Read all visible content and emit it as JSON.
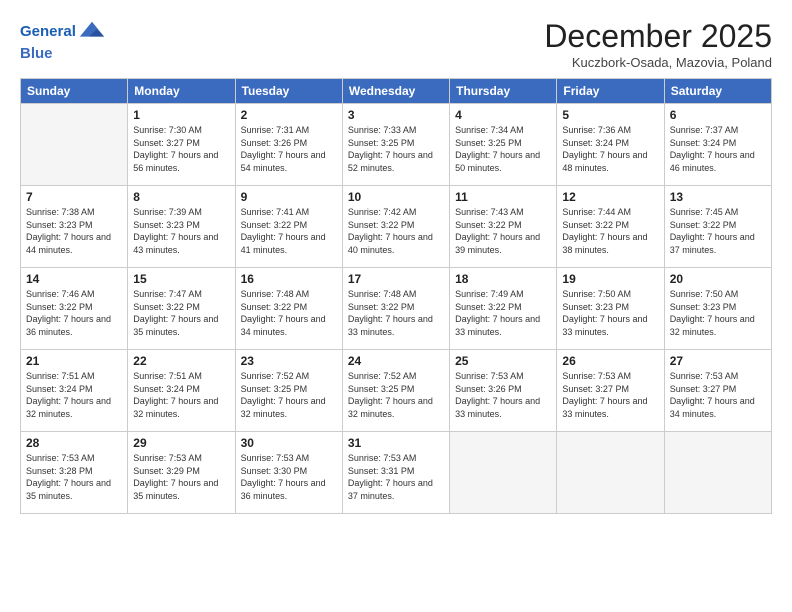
{
  "logo": {
    "line1": "General",
    "line2": "Blue"
  },
  "header": {
    "title": "December 2025",
    "location": "Kuczbork-Osada, Mazovia, Poland"
  },
  "weekdays": [
    "Sunday",
    "Monday",
    "Tuesday",
    "Wednesday",
    "Thursday",
    "Friday",
    "Saturday"
  ],
  "weeks": [
    [
      {
        "day": "",
        "sunrise": "",
        "sunset": "",
        "daylight": ""
      },
      {
        "day": "1",
        "sunrise": "Sunrise: 7:30 AM",
        "sunset": "Sunset: 3:27 PM",
        "daylight": "Daylight: 7 hours and 56 minutes."
      },
      {
        "day": "2",
        "sunrise": "Sunrise: 7:31 AM",
        "sunset": "Sunset: 3:26 PM",
        "daylight": "Daylight: 7 hours and 54 minutes."
      },
      {
        "day": "3",
        "sunrise": "Sunrise: 7:33 AM",
        "sunset": "Sunset: 3:25 PM",
        "daylight": "Daylight: 7 hours and 52 minutes."
      },
      {
        "day": "4",
        "sunrise": "Sunrise: 7:34 AM",
        "sunset": "Sunset: 3:25 PM",
        "daylight": "Daylight: 7 hours and 50 minutes."
      },
      {
        "day": "5",
        "sunrise": "Sunrise: 7:36 AM",
        "sunset": "Sunset: 3:24 PM",
        "daylight": "Daylight: 7 hours and 48 minutes."
      },
      {
        "day": "6",
        "sunrise": "Sunrise: 7:37 AM",
        "sunset": "Sunset: 3:24 PM",
        "daylight": "Daylight: 7 hours and 46 minutes."
      }
    ],
    [
      {
        "day": "7",
        "sunrise": "Sunrise: 7:38 AM",
        "sunset": "Sunset: 3:23 PM",
        "daylight": "Daylight: 7 hours and 44 minutes."
      },
      {
        "day": "8",
        "sunrise": "Sunrise: 7:39 AM",
        "sunset": "Sunset: 3:23 PM",
        "daylight": "Daylight: 7 hours and 43 minutes."
      },
      {
        "day": "9",
        "sunrise": "Sunrise: 7:41 AM",
        "sunset": "Sunset: 3:22 PM",
        "daylight": "Daylight: 7 hours and 41 minutes."
      },
      {
        "day": "10",
        "sunrise": "Sunrise: 7:42 AM",
        "sunset": "Sunset: 3:22 PM",
        "daylight": "Daylight: 7 hours and 40 minutes."
      },
      {
        "day": "11",
        "sunrise": "Sunrise: 7:43 AM",
        "sunset": "Sunset: 3:22 PM",
        "daylight": "Daylight: 7 hours and 39 minutes."
      },
      {
        "day": "12",
        "sunrise": "Sunrise: 7:44 AM",
        "sunset": "Sunset: 3:22 PM",
        "daylight": "Daylight: 7 hours and 38 minutes."
      },
      {
        "day": "13",
        "sunrise": "Sunrise: 7:45 AM",
        "sunset": "Sunset: 3:22 PM",
        "daylight": "Daylight: 7 hours and 37 minutes."
      }
    ],
    [
      {
        "day": "14",
        "sunrise": "Sunrise: 7:46 AM",
        "sunset": "Sunset: 3:22 PM",
        "daylight": "Daylight: 7 hours and 36 minutes."
      },
      {
        "day": "15",
        "sunrise": "Sunrise: 7:47 AM",
        "sunset": "Sunset: 3:22 PM",
        "daylight": "Daylight: 7 hours and 35 minutes."
      },
      {
        "day": "16",
        "sunrise": "Sunrise: 7:48 AM",
        "sunset": "Sunset: 3:22 PM",
        "daylight": "Daylight: 7 hours and 34 minutes."
      },
      {
        "day": "17",
        "sunrise": "Sunrise: 7:48 AM",
        "sunset": "Sunset: 3:22 PM",
        "daylight": "Daylight: 7 hours and 33 minutes."
      },
      {
        "day": "18",
        "sunrise": "Sunrise: 7:49 AM",
        "sunset": "Sunset: 3:22 PM",
        "daylight": "Daylight: 7 hours and 33 minutes."
      },
      {
        "day": "19",
        "sunrise": "Sunrise: 7:50 AM",
        "sunset": "Sunset: 3:23 PM",
        "daylight": "Daylight: 7 hours and 33 minutes."
      },
      {
        "day": "20",
        "sunrise": "Sunrise: 7:50 AM",
        "sunset": "Sunset: 3:23 PM",
        "daylight": "Daylight: 7 hours and 32 minutes."
      }
    ],
    [
      {
        "day": "21",
        "sunrise": "Sunrise: 7:51 AM",
        "sunset": "Sunset: 3:24 PM",
        "daylight": "Daylight: 7 hours and 32 minutes."
      },
      {
        "day": "22",
        "sunrise": "Sunrise: 7:51 AM",
        "sunset": "Sunset: 3:24 PM",
        "daylight": "Daylight: 7 hours and 32 minutes."
      },
      {
        "day": "23",
        "sunrise": "Sunrise: 7:52 AM",
        "sunset": "Sunset: 3:25 PM",
        "daylight": "Daylight: 7 hours and 32 minutes."
      },
      {
        "day": "24",
        "sunrise": "Sunrise: 7:52 AM",
        "sunset": "Sunset: 3:25 PM",
        "daylight": "Daylight: 7 hours and 32 minutes."
      },
      {
        "day": "25",
        "sunrise": "Sunrise: 7:53 AM",
        "sunset": "Sunset: 3:26 PM",
        "daylight": "Daylight: 7 hours and 33 minutes."
      },
      {
        "day": "26",
        "sunrise": "Sunrise: 7:53 AM",
        "sunset": "Sunset: 3:27 PM",
        "daylight": "Daylight: 7 hours and 33 minutes."
      },
      {
        "day": "27",
        "sunrise": "Sunrise: 7:53 AM",
        "sunset": "Sunset: 3:27 PM",
        "daylight": "Daylight: 7 hours and 34 minutes."
      }
    ],
    [
      {
        "day": "28",
        "sunrise": "Sunrise: 7:53 AM",
        "sunset": "Sunset: 3:28 PM",
        "daylight": "Daylight: 7 hours and 35 minutes."
      },
      {
        "day": "29",
        "sunrise": "Sunrise: 7:53 AM",
        "sunset": "Sunset: 3:29 PM",
        "daylight": "Daylight: 7 hours and 35 minutes."
      },
      {
        "day": "30",
        "sunrise": "Sunrise: 7:53 AM",
        "sunset": "Sunset: 3:30 PM",
        "daylight": "Daylight: 7 hours and 36 minutes."
      },
      {
        "day": "31",
        "sunrise": "Sunrise: 7:53 AM",
        "sunset": "Sunset: 3:31 PM",
        "daylight": "Daylight: 7 hours and 37 minutes."
      },
      {
        "day": "",
        "sunrise": "",
        "sunset": "",
        "daylight": ""
      },
      {
        "day": "",
        "sunrise": "",
        "sunset": "",
        "daylight": ""
      },
      {
        "day": "",
        "sunrise": "",
        "sunset": "",
        "daylight": ""
      }
    ]
  ]
}
